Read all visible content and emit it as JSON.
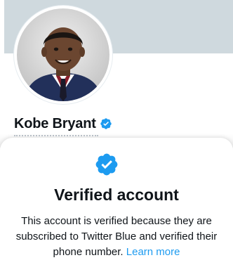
{
  "colors": {
    "banner": "#cfd9de",
    "verified_blue": "#1d9bf0",
    "text_primary": "#0f1419",
    "link": "#1d9bf0"
  },
  "profile": {
    "display_name": "Kobe Bryant",
    "verified_icon": "verified-badge-icon",
    "avatar": "profile-photo"
  },
  "verified_sheet": {
    "icon": "verified-badge-icon",
    "title": "Verified account",
    "body": "This account is verified because they are subscribed to Twitter Blue and verified their phone number.",
    "link_label": "Learn more"
  }
}
